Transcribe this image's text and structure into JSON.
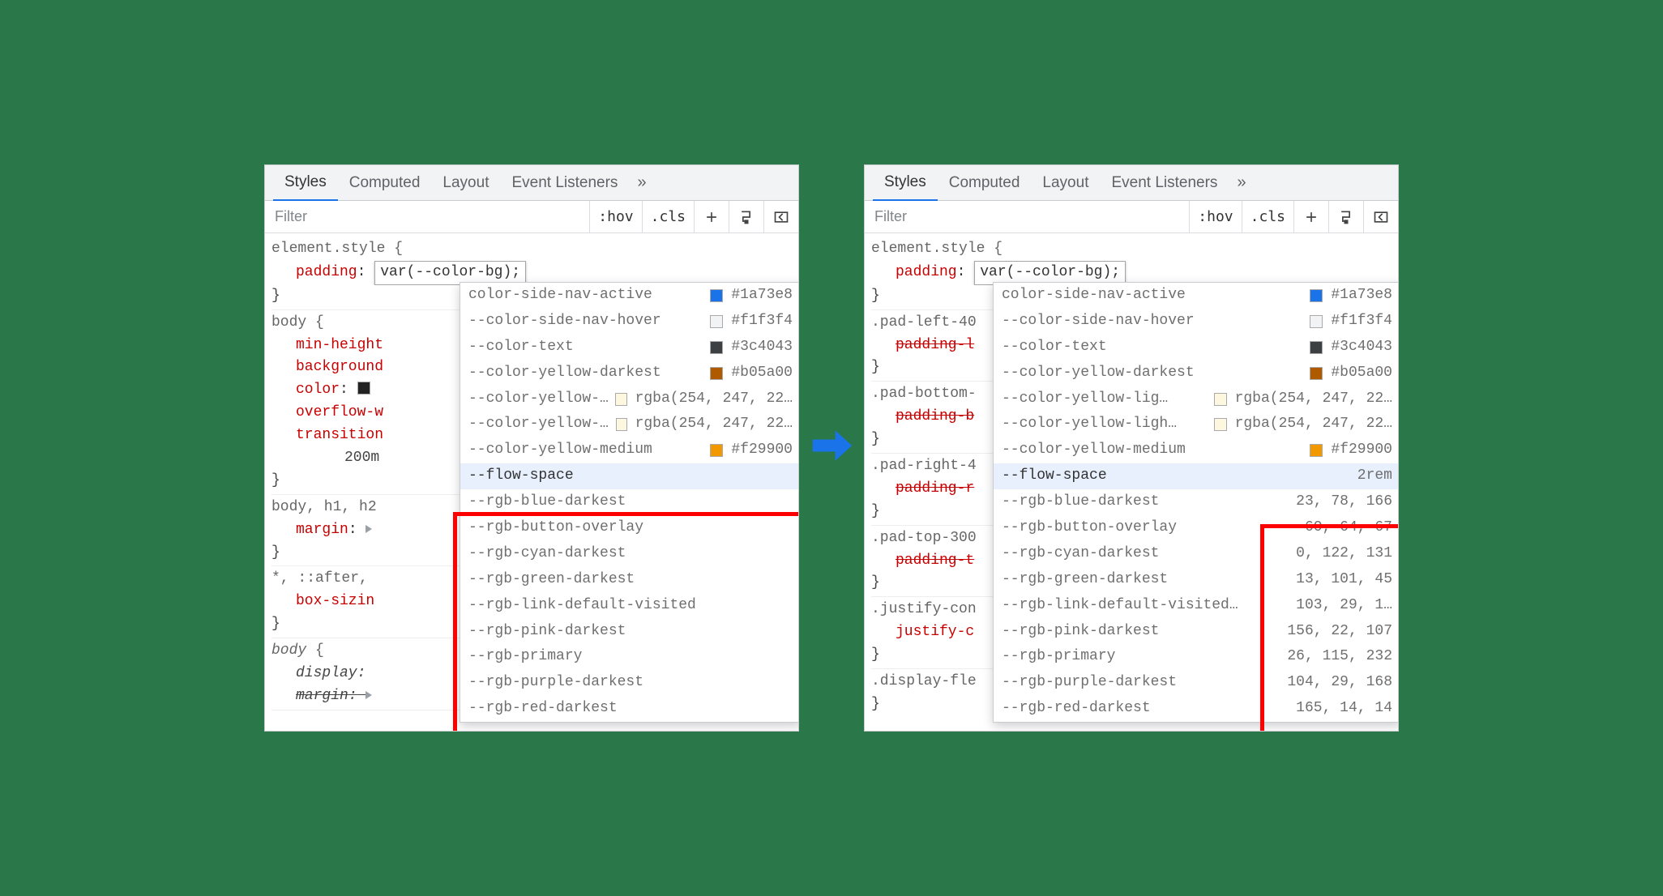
{
  "tabs": [
    "Styles",
    "Computed",
    "Layout",
    "Event Listeners"
  ],
  "tabs_more": "»",
  "filter_placeholder": "Filter",
  "toolbar_buttons": {
    "hov": ":hov",
    "cls": ".cls"
  },
  "element_style": {
    "selector": "element.style",
    "prop": "padding",
    "value_editing": "var(--color-bg);"
  },
  "left": {
    "body_selector": "body",
    "body_props": [
      {
        "name": "min-height"
      },
      {
        "name": "background"
      },
      {
        "name": "color",
        "swatch": "#222"
      },
      {
        "name": "overflow-w"
      },
      {
        "name": "transition"
      }
    ],
    "transition_tail": "200m",
    "bodyh1_selector": "body, h1, h2",
    "margin_prop": "margin",
    "star_selector": "*, ::after,",
    "boxsizing_prop": "box-sizin",
    "body2_selector": "body",
    "display_prop": "display",
    "margin2_prop": "margin"
  },
  "right": {
    "rules": [
      {
        "selector": ".pad-left-40",
        "prop": "padding-l"
      },
      {
        "selector": ".pad-bottom-",
        "prop": "padding-b"
      },
      {
        "selector": ".pad-right-4",
        "prop": "padding-r"
      },
      {
        "selector": ".pad-top-300",
        "prop": "padding-t"
      },
      {
        "selector": ".justify-con",
        "prop": "justify-c",
        "strike": false
      },
      {
        "selector": ".display-fle",
        "prop": null
      }
    ]
  },
  "autocomplete_colors": [
    {
      "name": "color-side-nav-active",
      "swatch": "#1a73e8",
      "value": "#1a73e8",
      "truncated": true
    },
    {
      "name": "--color-side-nav-hover",
      "swatch": "#f1f3f4",
      "value": "#f1f3f4"
    },
    {
      "name": "--color-text",
      "swatch": "#3c4043",
      "value": "#3c4043"
    },
    {
      "name": "--color-yellow-darkest",
      "swatch": "#b05a00",
      "value": "#b05a00"
    },
    {
      "name": "--color-yellow-lig…",
      "swatch": "#fef7df",
      "value": "rgba(254, 247, 22…"
    },
    {
      "name": "--color-yellow-ligh…",
      "swatch": "#fef7df",
      "value": "rgba(254, 247, 22…"
    },
    {
      "name": "--color-yellow-medium",
      "swatch": "#f29900",
      "value": "#f29900"
    }
  ],
  "autocomplete_rgb_left": [
    {
      "name": "--flow-space",
      "hl": true
    },
    {
      "name": "--rgb-blue-darkest"
    },
    {
      "name": "--rgb-button-overlay"
    },
    {
      "name": "--rgb-cyan-darkest"
    },
    {
      "name": "--rgb-green-darkest"
    },
    {
      "name": "--rgb-link-default-visited"
    },
    {
      "name": "--rgb-pink-darkest"
    },
    {
      "name": "--rgb-primary"
    },
    {
      "name": "--rgb-purple-darkest"
    },
    {
      "name": "--rgb-red-darkest"
    }
  ],
  "autocomplete_rgb_right": [
    {
      "name": "--flow-space",
      "value": "2rem",
      "hl": true
    },
    {
      "name": "--rgb-blue-darkest",
      "value": "23, 78, 166"
    },
    {
      "name": "--rgb-button-overlay",
      "value": "60, 64, 67"
    },
    {
      "name": "--rgb-cyan-darkest",
      "value": "0, 122, 131"
    },
    {
      "name": "--rgb-green-darkest",
      "value": "13, 101, 45"
    },
    {
      "name": "--rgb-link-default-visited…",
      "value": "103, 29, 1…"
    },
    {
      "name": "--rgb-pink-darkest",
      "value": "156, 22, 107"
    },
    {
      "name": "--rgb-primary",
      "value": "26, 115, 232"
    },
    {
      "name": "--rgb-purple-darkest",
      "value": "104, 29, 168"
    },
    {
      "name": "--rgb-red-darkest",
      "value": "165, 14, 14"
    }
  ]
}
